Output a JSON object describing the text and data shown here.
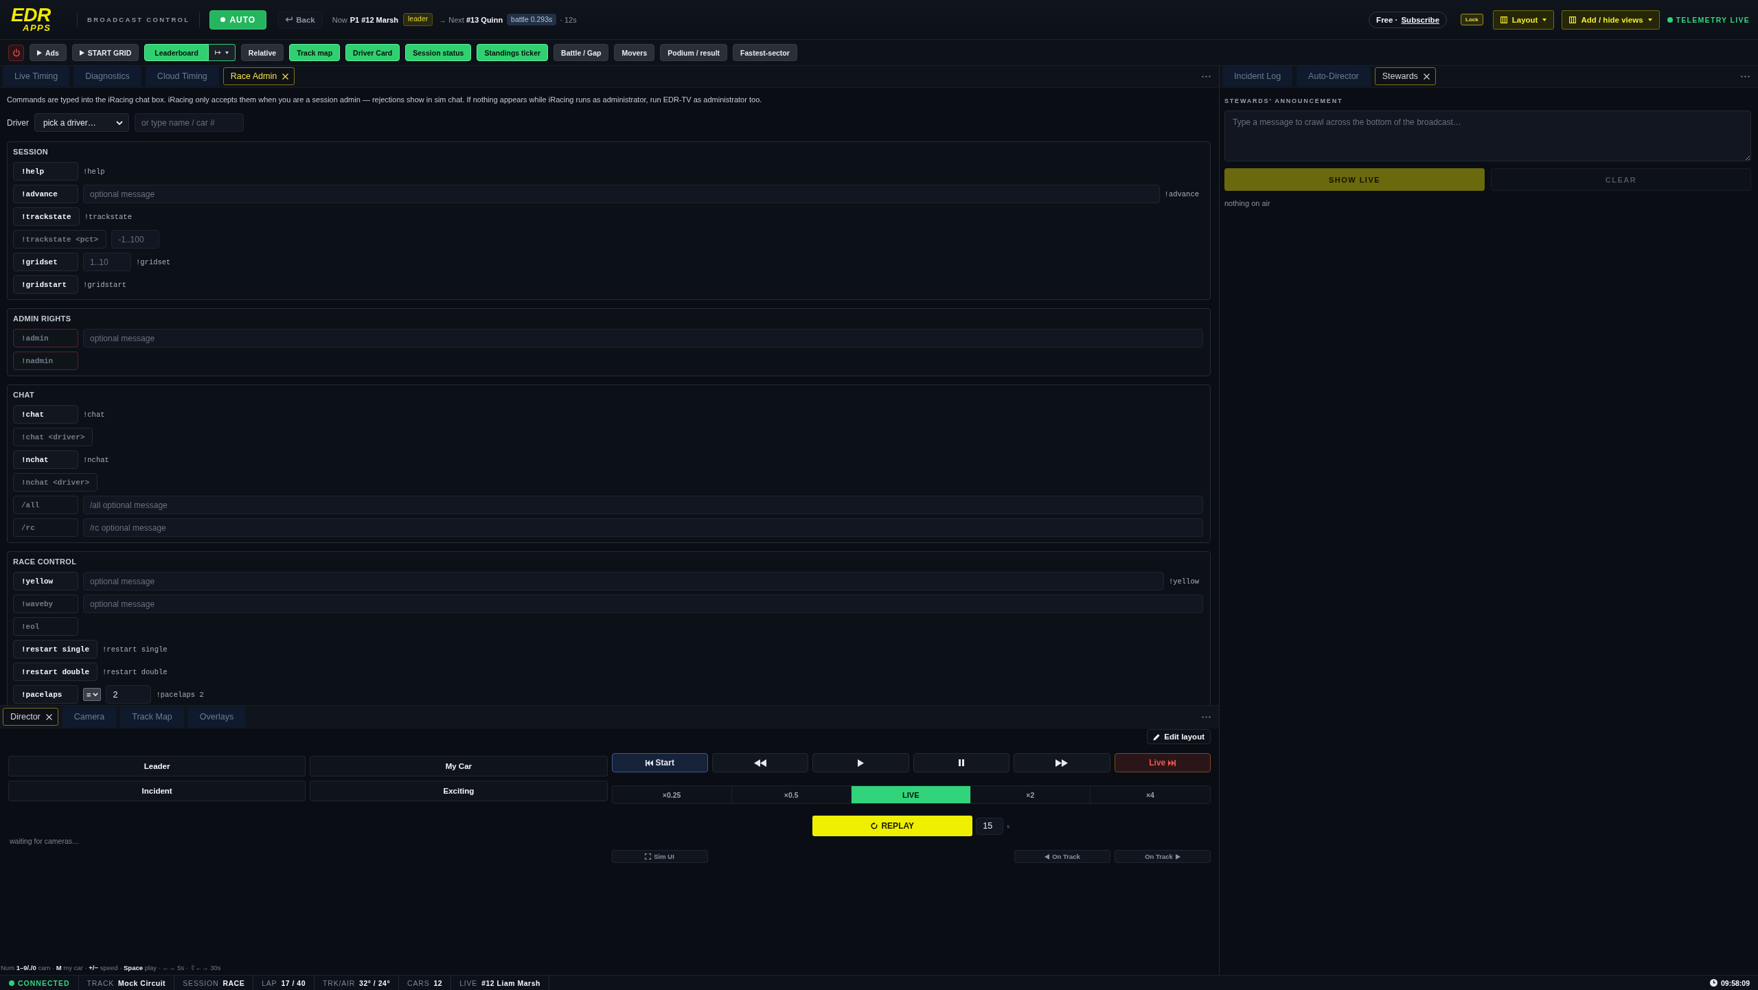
{
  "header": {
    "logo": {
      "wordmark": "EDR",
      "subline": "APPS"
    },
    "app_title": "BROADCAST CONTROL",
    "auto_button": {
      "label": "AUTO",
      "on": true
    },
    "back_button": {
      "label": "Back"
    },
    "now": {
      "label": "Now",
      "value": "P1 #12 Marsh",
      "tag": "leader"
    },
    "next": {
      "label": "→ Next",
      "value": "#13 Quinn",
      "tag": "battle 0.293s",
      "eta": "· 12s"
    },
    "plan": {
      "label": "Free ·",
      "link": "Subscribe"
    },
    "lock_button": {
      "label": "Lock"
    },
    "layout_button": {
      "label": "Layout"
    },
    "views_button": {
      "label": "Add / hide views"
    },
    "telemetry": {
      "label": "TELEMETRY LIVE",
      "on": true
    }
  },
  "toolbar": {
    "actions": [
      {
        "label": "Ads"
      },
      {
        "label": "START GRID"
      }
    ],
    "overlays": [
      {
        "label": "Leaderboard",
        "kind": "split",
        "on": true
      },
      {
        "label": "Relative",
        "kind": "toggle",
        "on": false
      },
      {
        "label": "Track map",
        "kind": "toggle",
        "on": true
      },
      {
        "label": "Driver Card",
        "kind": "toggle",
        "on": true
      },
      {
        "label": "Session status",
        "kind": "toggle",
        "on": true
      },
      {
        "label": "Standings ticker",
        "kind": "toggle",
        "on": true
      },
      {
        "label": "Battle / Gap",
        "kind": "toggle",
        "on": false
      },
      {
        "label": "Movers",
        "kind": "toggle",
        "on": false
      },
      {
        "label": "Podium / result",
        "kind": "toggle",
        "on": false
      },
      {
        "label": "Fastest-sector",
        "kind": "toggle",
        "on": false
      }
    ]
  },
  "left_panel": {
    "focused": true,
    "tabs": [
      {
        "label": "Live Timing",
        "selected": false
      },
      {
        "label": "Diagnostics",
        "selected": false
      },
      {
        "label": "Cloud Timing",
        "selected": false
      },
      {
        "label": "Race Admin",
        "selected": true
      }
    ],
    "race_admin": {
      "note": "Commands are typed into the iRacing chat box. iRacing only accepts them when you are a session admin — rejections show in sim chat. If nothing appears while iRacing runs as administrator, run EDR-TV as administrator too.",
      "driver": {
        "label": "Driver",
        "value": "pick a driver…",
        "search_placeholder": "or type name / car #"
      },
      "sections": [
        {
          "title": "SESSION",
          "commands": [
            {
              "command": "!help",
              "kind": "preview",
              "disabled": false,
              "danger": false,
              "preview": "!help"
            },
            {
              "command": "!advance",
              "kind": "message",
              "disabled": false,
              "danger": false,
              "placeholder": "optional message",
              "preview": "!advance"
            },
            {
              "command": "!trackstate",
              "kind": "preview",
              "disabled": false,
              "danger": false,
              "preview": "!trackstate"
            },
            {
              "command": "!trackstate <pct>",
              "kind": "number",
              "disabled": true,
              "danger": false,
              "placeholder": "-1..100"
            },
            {
              "command": "!gridset",
              "kind": "number",
              "disabled": false,
              "danger": false,
              "placeholder": "1..10",
              "preview": "!gridset"
            },
            {
              "command": "!gridstart",
              "kind": "preview",
              "disabled": false,
              "danger": false,
              "preview": "!gridstart"
            }
          ]
        },
        {
          "title": "ADMIN RIGHTS",
          "commands": [
            {
              "command": "!admin",
              "kind": "message",
              "disabled": true,
              "danger": true,
              "placeholder": "optional message"
            },
            {
              "command": "!nadmin",
              "kind": "button",
              "disabled": true,
              "danger": true
            }
          ]
        },
        {
          "title": "CHAT",
          "commands": [
            {
              "command": "!chat",
              "kind": "preview",
              "disabled": false,
              "danger": false,
              "preview": "!chat"
            },
            {
              "command": "!chat <driver>",
              "kind": "button",
              "disabled": true,
              "danger": false
            },
            {
              "command": "!nchat",
              "kind": "preview",
              "disabled": false,
              "danger": false,
              "preview": "!nchat"
            },
            {
              "command": "!nchat <driver>",
              "kind": "button",
              "disabled": true,
              "danger": false
            },
            {
              "command": "/all",
              "kind": "message",
              "disabled": true,
              "danger": false,
              "placeholder": "/all optional message"
            },
            {
              "command": "/rc",
              "kind": "message",
              "disabled": true,
              "danger": false,
              "placeholder": "/rc optional message"
            }
          ]
        },
        {
          "title": "RACE CONTROL",
          "commands": [
            {
              "command": "!yellow",
              "kind": "message",
              "disabled": false,
              "danger": false,
              "placeholder": "optional message",
              "preview": "!yellow"
            },
            {
              "command": "!waveby",
              "kind": "message",
              "disabled": true,
              "danger": false,
              "placeholder": "optional message"
            },
            {
              "command": "!eol",
              "kind": "button",
              "disabled": true,
              "danger": false
            },
            {
              "command": "!restart single",
              "kind": "preview",
              "disabled": false,
              "danger": false,
              "preview": "!restart single"
            },
            {
              "command": "!restart double",
              "kind": "preview",
              "disabled": false,
              "danger": false,
              "preview": "!restart double"
            },
            {
              "command": "!pacelaps",
              "kind": "pacelaps",
              "disabled": false,
              "danger": false,
              "operator": "=",
              "value": "2",
              "preview": "!pacelaps 2"
            }
          ]
        }
      ]
    }
  },
  "bottom_panel": {
    "focused": false,
    "tabs": [
      {
        "label": "Director",
        "selected": true
      },
      {
        "label": "Camera",
        "selected": false
      },
      {
        "label": "Track Map",
        "selected": false
      },
      {
        "label": "Overlays",
        "selected": false
      }
    ],
    "director": {
      "edit_layout_button": {
        "label": "Edit layout"
      },
      "cameras": [
        {
          "label": "Leader"
        },
        {
          "label": "My Car"
        },
        {
          "label": "Incident"
        },
        {
          "label": "Exciting"
        }
      ],
      "status": "waiting for cameras…",
      "transport": [
        {
          "kind": "start",
          "label": "Start",
          "selected": true
        },
        {
          "kind": "rewind",
          "selected": false
        },
        {
          "kind": "play",
          "selected": false
        },
        {
          "kind": "pause",
          "selected": false
        },
        {
          "kind": "fast_forward",
          "selected": false
        },
        {
          "kind": "live",
          "label": "Live",
          "selected": false
        }
      ],
      "speeds": [
        {
          "label": "×0.25",
          "selected": false
        },
        {
          "label": "×0.5",
          "selected": false
        },
        {
          "label": "LIVE",
          "selected": true
        },
        {
          "label": "×2",
          "selected": false
        },
        {
          "label": "×4",
          "selected": false
        }
      ],
      "replay": {
        "label": "REPLAY",
        "seconds": "15",
        "unit": "s"
      },
      "sim_ui_button": {
        "label": "Sim UI"
      },
      "on_track_buttons": [
        {
          "kind": "previous",
          "label": "On Track"
        },
        {
          "kind": "next",
          "label": "On Track"
        }
      ]
    }
  },
  "hints": "Num **1–9/./0** cam · **M** my car · **+/−** speed · **Space** play · ←→ 5s · ⇧←→ 30s",
  "right_panel": {
    "focused": false,
    "tabs": [
      {
        "label": "Incident Log",
        "selected": false
      },
      {
        "label": "Auto-Director",
        "selected": false
      },
      {
        "label": "Stewards",
        "selected": true
      }
    ],
    "stewards": {
      "title": "STEWARDS’ ANNOUNCEMENT",
      "message_placeholder": "Type a message to crawl across the bottom of the broadcast…",
      "show_live_button": "SHOW LIVE",
      "clear_button": "CLEAR",
      "status": "nothing on air"
    }
  },
  "status_bar": {
    "connection": {
      "label": "CONNECTED",
      "on": true
    },
    "items": [
      {
        "label": "TRACK",
        "value": "Mock Circuit"
      },
      {
        "label": "SESSION",
        "value": "RACE"
      },
      {
        "label": "LAP",
        "value": "17 / 40"
      },
      {
        "label": "TRK/AIR",
        "value": "32° / 24°"
      },
      {
        "label": "CARS",
        "value": "12"
      },
      {
        "label": "LIVE",
        "value": "#12 Liam Marsh"
      }
    ],
    "clock": "09:58:09"
  }
}
